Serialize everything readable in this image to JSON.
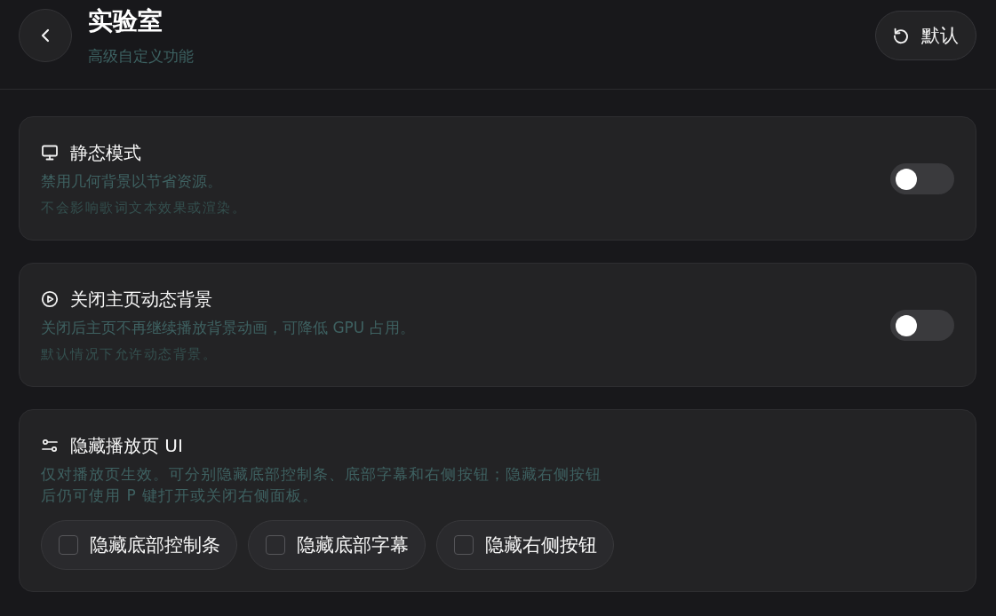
{
  "header": {
    "title": "实验室",
    "subtitle": "高级自定义功能",
    "default_button": {
      "label": "默认"
    }
  },
  "settings": [
    {
      "kind": "toggle",
      "title": "静态模式",
      "description": "禁用几何背景以节省资源。",
      "note": "不会影响歌词文本效果或渲染。",
      "on": false
    },
    {
      "kind": "toggle",
      "title": "关闭主页动态背景",
      "description": "关闭后主页不再继续播放背景动画，可降低 GPU 占用。",
      "note": "默认情况下允许动态背景。",
      "on": false
    },
    {
      "kind": "checkbox_group",
      "title": "隐藏播放页 UI",
      "description": "仅对播放页生效。可分别隐藏底部控制条、底部字幕和右侧按钮；隐藏右侧按钮后仍可使用 P 键打开或关闭右侧面板。",
      "options": [
        {
          "label": "隐藏底部控制条",
          "checked": false
        },
        {
          "label": "隐藏底部字幕",
          "checked": false
        },
        {
          "label": "隐藏右侧按钮",
          "checked": false
        }
      ]
    }
  ]
}
